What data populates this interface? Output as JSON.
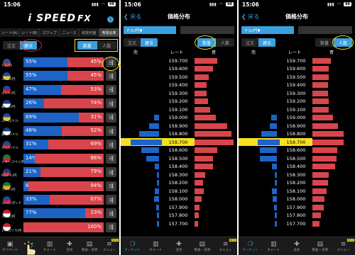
{
  "status": {
    "time": "15:06",
    "battery": "98"
  },
  "panel1": {
    "logo_main": "i SPEED",
    "logo_fx": "FX",
    "currency_tabs": [
      "レート(A)",
      "レート(B)",
      "スワップ",
      "ニュース",
      "約定代金",
      "売買比率"
    ],
    "seg_left": [
      "注文",
      "建玉"
    ],
    "seg_right": [
      "数量",
      "人数"
    ],
    "rows": [
      {
        "ccy": "ドル/円",
        "buy": "55%",
        "sell": "45%",
        "buy_ratio": 0.55,
        "flag_a": "#2255aa",
        "flag_b": "#cc2233"
      },
      {
        "ccy": "ユーロ/円",
        "buy": "55%",
        "sell": "45%",
        "buy_ratio": 0.55,
        "flag_a": "#2244aa",
        "flag_b": "#ddcc22"
      },
      {
        "ccy": "ポンド/円",
        "buy": "47%",
        "sell": "53%",
        "buy_ratio": 0.47,
        "flag_a": "#224499",
        "flag_b": "#cc2233"
      },
      {
        "ccy": "豪ドル/円",
        "buy": "26%",
        "sell": "74%",
        "buy_ratio": 0.26,
        "flag_a": "#1a3a8a",
        "flag_b": "#ffffff"
      },
      {
        "ccy": "ユーロ/ドル",
        "buy": "69%",
        "sell": "31%",
        "buy_ratio": 0.69,
        "flag_a": "#2244aa",
        "flag_b": "#ddcc22"
      },
      {
        "ccy": "豪ドル/ドル",
        "buy": "48%",
        "sell": "52%",
        "buy_ratio": 0.48,
        "flag_a": "#1a3a8a",
        "flag_b": "#ffffff"
      },
      {
        "ccy": "ポンド/ドル",
        "buy": "31%",
        "sell": "69%",
        "buy_ratio": 0.31,
        "flag_a": "#224499",
        "flag_b": "#cc2233"
      },
      {
        "ccy": "メキシコペソ/円",
        "buy": "14%",
        "sell": "86%",
        "buy_ratio": 0.14,
        "flag_a": "#1a7a3a",
        "flag_b": "#cc2233"
      },
      {
        "ccy": "NZドル/円",
        "buy": "21%",
        "sell": "79%",
        "buy_ratio": 0.21,
        "flag_a": "#1a3a8a",
        "flag_b": "#cc2233"
      },
      {
        "ccy": "ランド/円",
        "buy": "6%",
        "sell": "94%",
        "buy_ratio": 0.06,
        "flag_a": "#1a7a3a",
        "flag_b": "#ddaa22"
      },
      {
        "ccy": "ユーロ/ポンド",
        "buy": "33%",
        "sell": "67%",
        "buy_ratio": 0.33,
        "flag_a": "#2244aa",
        "flag_b": "#cc2233"
      },
      {
        "ccy": "スイス/円",
        "buy": "77%",
        "sell": "23%",
        "buy_ratio": 0.77,
        "flag_a": "#cc2233",
        "flag_b": "#ffffff"
      },
      {
        "ccy": "トルコリラ/円",
        "buy": "0%",
        "sell": "100%",
        "buy_ratio": 0.0,
        "flag_a": "#cc2233",
        "flag_b": "#ffffff"
      }
    ],
    "tabs": [
      {
        "icon": "▣",
        "label": "マイページ"
      },
      {
        "icon": "❍",
        "label": ""
      },
      {
        "icon": "▥",
        "label": "チャート"
      },
      {
        "icon": "✚",
        "label": "注文"
      },
      {
        "icon": "▤",
        "label": "照会・決済"
      },
      {
        "icon": "≡",
        "label": "メニュー"
      }
    ]
  },
  "distribution": {
    "back": "戻る",
    "title": "価格分布",
    "pair": "ドル/円▼",
    "seg_left": [
      "注文",
      "建玉"
    ],
    "seg_right": [
      "数量",
      "人数"
    ],
    "col_sell": "売",
    "col_rate": "レート",
    "col_buy": "買",
    "current_price": "158.700",
    "prices": [
      "159.700",
      "159.600",
      "159.500",
      "159.400",
      "159.300",
      "159.200",
      "159.100",
      "159.000",
      "158.900",
      "158.800",
      "158.700",
      "158.600",
      "158.500",
      "158.400",
      "158.300",
      "158.200",
      "158.100",
      "158.000",
      "157.900",
      "157.800",
      "157.700"
    ],
    "panel2_sell": [
      0,
      0,
      0,
      0,
      0,
      0,
      0,
      0.12,
      0.25,
      0.5,
      0.78,
      0.44,
      0.33,
      0.1,
      0.05,
      0.05,
      0.1,
      0.13,
      0.08,
      0.05,
      0.05
    ],
    "panel2_buy": [
      0.55,
      0.45,
      0.35,
      0.3,
      0.3,
      0.33,
      0.38,
      0.52,
      0.8,
      0.9,
      0.95,
      0.55,
      0.45,
      0.45,
      0.25,
      0.2,
      0.22,
      0.18,
      0.12,
      0.1,
      0.08
    ],
    "panel3_sell": [
      0,
      0,
      0,
      0,
      0,
      0,
      0,
      0.14,
      0.18,
      0.4,
      0.55,
      0.42,
      0.42,
      0.12,
      0.06,
      0.06,
      0.12,
      0.1,
      0.08,
      0.06,
      0.06
    ],
    "panel3_buy": [
      0.45,
      0.4,
      0.4,
      0.38,
      0.38,
      0.4,
      0.4,
      0.5,
      0.62,
      0.75,
      0.75,
      0.6,
      0.58,
      0.55,
      0.4,
      0.38,
      0.35,
      0.3,
      0.28,
      0.2,
      0.18
    ],
    "tabs": [
      {
        "icon": "❍",
        "label": "マーケット"
      },
      {
        "icon": "▥",
        "label": "チャート"
      },
      {
        "icon": "✚",
        "label": "注文"
      },
      {
        "icon": "▤",
        "label": "照会・決済"
      },
      {
        "icon": "≡",
        "label": "メニュー"
      }
    ]
  },
  "colors": {
    "buy": "#1e63c6",
    "sell": "#d9454c",
    "accent": "#3aa0e0",
    "highlight": "#f5e11e"
  }
}
